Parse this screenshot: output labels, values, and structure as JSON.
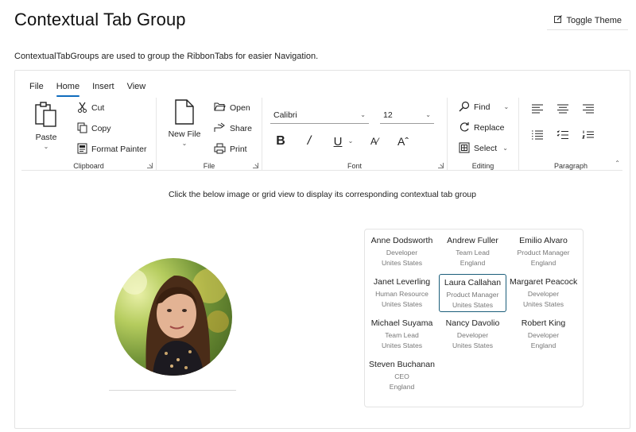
{
  "page": {
    "title": "Contextual Tab Group",
    "toggle_theme": "Toggle Theme",
    "description": "ContextualTabGroups are used to group the RibbonTabs for easier Navigation."
  },
  "ribbon": {
    "tabs": [
      {
        "label": "File"
      },
      {
        "label": "Home",
        "active": true
      },
      {
        "label": "Insert"
      },
      {
        "label": "View"
      }
    ],
    "clipboard": {
      "label": "Clipboard",
      "paste": "Paste",
      "cut": "Cut",
      "copy": "Copy",
      "format_painter": "Format Painter"
    },
    "file": {
      "label": "File",
      "new_file": "New File",
      "open": "Open",
      "share": "Share",
      "print": "Print"
    },
    "font": {
      "label": "Font",
      "family": "Calibri",
      "size": "12"
    },
    "editing": {
      "label": "Editing",
      "find": "Find",
      "replace": "Replace",
      "select": "Select"
    },
    "paragraph": {
      "label": "Paragraph"
    }
  },
  "instruction": "Click the below image or grid view to display its corresponding contextual tab group",
  "employees": [
    {
      "name": "Anne Dodsworth",
      "role": "Developer",
      "location": "Unites States"
    },
    {
      "name": "Andrew Fuller",
      "role": "Team Lead",
      "location": "England"
    },
    {
      "name": "Emilio Alvaro",
      "role": "Product Manager",
      "location": "England"
    },
    {
      "name": "Janet Leverling",
      "role": "Human Resource",
      "location": "Unites States"
    },
    {
      "name": "Laura Callahan",
      "role": "Product Manager",
      "location": "Unites States",
      "selected": true
    },
    {
      "name": "Margaret Peacock",
      "role": "Developer",
      "location": "Unites States"
    },
    {
      "name": "Michael Suyama",
      "role": "Team Lead",
      "location": "Unites States"
    },
    {
      "name": "Nancy Davolio",
      "role": "Developer",
      "location": "Unites States"
    },
    {
      "name": "Robert King",
      "role": "Developer",
      "location": "England"
    },
    {
      "name": "Steven Buchanan",
      "role": "CEO",
      "location": "England"
    }
  ],
  "icons": {
    "toggle_theme": "edit-icon",
    "paste": "clipboard-icon",
    "cut": "scissors-icon",
    "copy": "copy-icon",
    "format_painter": "paint-brush-icon",
    "new_file": "document-icon",
    "open": "folder-icon",
    "share": "share-icon",
    "print": "printer-icon",
    "find": "search-icon",
    "replace": "refresh-icon",
    "select": "select-all-icon"
  },
  "colors": {
    "accent": "#0f6cbd",
    "selected_border": "#1b5e7a"
  }
}
